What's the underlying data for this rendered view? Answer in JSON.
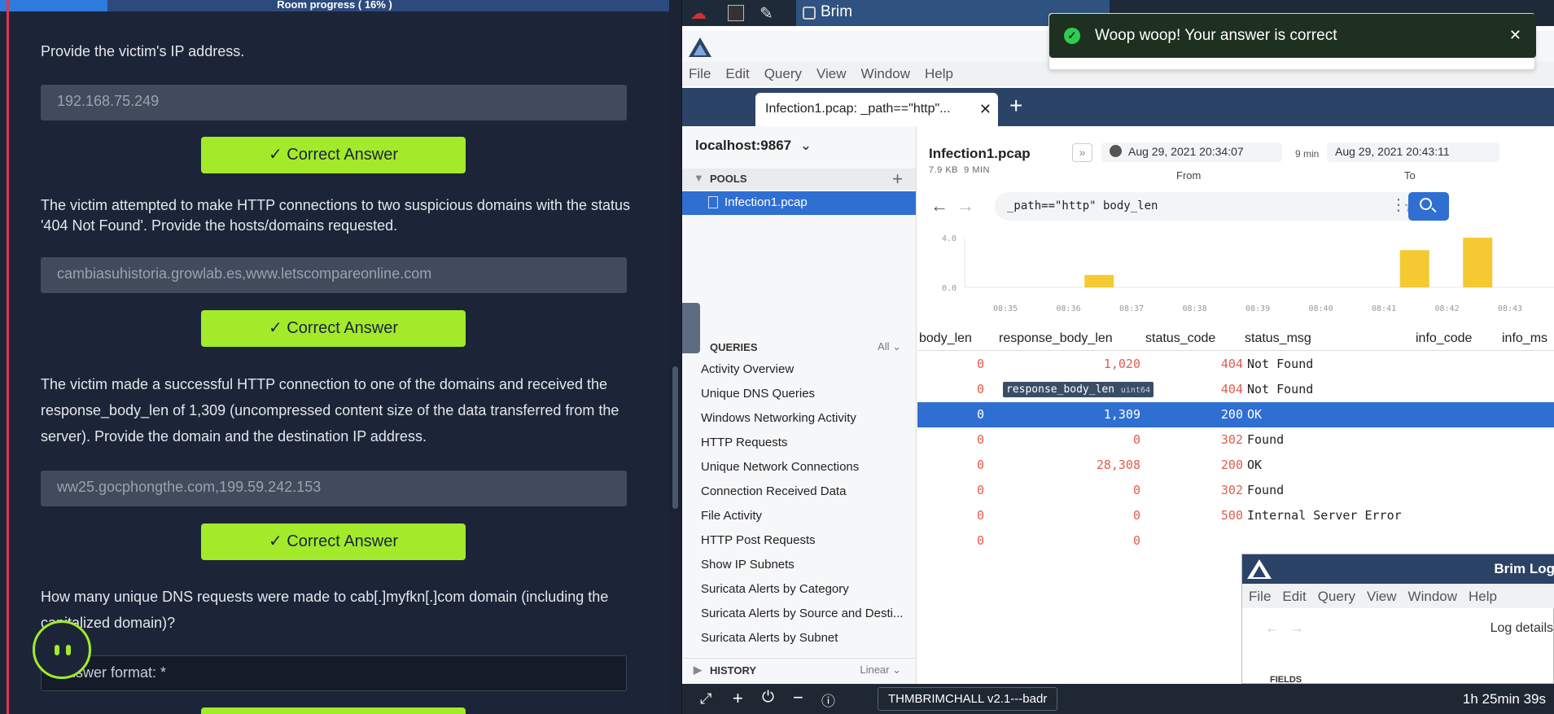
{
  "room": {
    "progress_label": "Room progress ( 16% )",
    "progress_fraction": 0.16
  },
  "questions": [
    {
      "text": "Provide the victim's IP address.",
      "answer": "192.168.75.249",
      "button": "✓ Correct Answer"
    },
    {
      "text": "The victim attempted to make HTTP connections to two suspicious domains with the status '404 Not Found'. Provide the hosts/domains requested.",
      "answer": "cambiasuhistoria.growlab.es,www.letscompareonline.com",
      "button": "✓ Correct Answer"
    },
    {
      "text": "The victim made a successful HTTP connection to one of the domains and received the response_body_len of 1,309 (uncompressed content size of the data transferred from the server). Provide the domain and the destination IP address.",
      "answer": "ww25.gocphongthe.com,199.59.242.153",
      "button": "✓ Correct Answer"
    },
    {
      "text": "How many unique DNS requests were made to cab[.]myfkn[.]com domain (including the capitalized domain)?",
      "placeholder": "Answer format: *"
    }
  ],
  "taskbar": {
    "app_name": "Brim"
  },
  "menu": [
    "File",
    "Edit",
    "Query",
    "View",
    "Window",
    "Help"
  ],
  "tab": {
    "title": "Infection1.pcap: _path==\"http\"..."
  },
  "sidebar": {
    "host": "localhost:9867",
    "pools_label": "POOLS",
    "pool_item": "Infection1.pcap",
    "queries_label": "QUERIES",
    "queries_filter": "All",
    "queries": [
      "Activity Overview",
      "Unique DNS Queries",
      "Windows Networking Activity",
      "HTTP Requests",
      "Unique Network Connections",
      "Connection Received Data",
      "File Activity",
      "HTTP Post Requests",
      "Show IP Subnets",
      "Suricata Alerts by Category",
      "Suricata Alerts by Source and Desti...",
      "Suricata Alerts by Subnet"
    ],
    "history_label": "HISTORY",
    "history_mode": "Linear"
  },
  "pool": {
    "name": "Infection1.pcap",
    "size": "7.9 KB",
    "duration": "9 MIN",
    "from_time": "Aug 29, 2021 20:34:07",
    "span": "9 min",
    "to_time": "Aug 29, 2021 20:43:11",
    "from_label": "From",
    "to_label": "To"
  },
  "search": {
    "query": "_path==\"http\" body_len"
  },
  "histogram": {
    "y_ticks": [
      "4.0",
      "0.0"
    ],
    "x_ticks": [
      "08:35",
      "08:36",
      "08:37",
      "08:38",
      "08:39",
      "08:40",
      "08:41",
      "08:42",
      "08:43"
    ],
    "bars": [
      {
        "minute": "08:36",
        "count": 1
      },
      {
        "minute": "08:41",
        "count": 3
      },
      {
        "minute": "08:42",
        "count": 4
      }
    ]
  },
  "table": {
    "columns": [
      "body_len",
      "response_body_len",
      "status_code",
      "status_msg",
      "info_code",
      "info_ms"
    ],
    "tooltip": {
      "name": "response_body_len",
      "type": "uint64"
    },
    "rows": [
      {
        "body_len": "0",
        "response_body_len": "1,020",
        "status_code": "404",
        "status_msg": "Not Found"
      },
      {
        "body_len": "0",
        "response_body_len": "",
        "status_code": "404",
        "status_msg": "Not Found"
      },
      {
        "body_len": "0",
        "response_body_len": "1,309",
        "status_code": "200",
        "status_msg": "OK",
        "selected": true
      },
      {
        "body_len": "0",
        "response_body_len": "0",
        "status_code": "302",
        "status_msg": "Found"
      },
      {
        "body_len": "0",
        "response_body_len": "28,308",
        "status_code": "200",
        "status_msg": "OK"
      },
      {
        "body_len": "0",
        "response_body_len": "0",
        "status_code": "302",
        "status_msg": "Found"
      },
      {
        "body_len": "0",
        "response_body_len": "0",
        "status_code": "500",
        "status_msg": "Internal Server Error"
      },
      {
        "body_len": "0",
        "response_body_len": "0",
        "status_code": "",
        "status_msg": ""
      }
    ]
  },
  "toast": {
    "message": "Woop woop! Your answer is correct"
  },
  "logwindow": {
    "title": "Brim Log",
    "menu": [
      "File",
      "Edit",
      "Query",
      "View",
      "Window",
      "Help"
    ],
    "heading": "Log details",
    "fields_label": "FIELDS"
  },
  "bottombar": {
    "machine": "THMBRIMCHALL v2.1---badr",
    "timer": "1h 25min 39s"
  }
}
